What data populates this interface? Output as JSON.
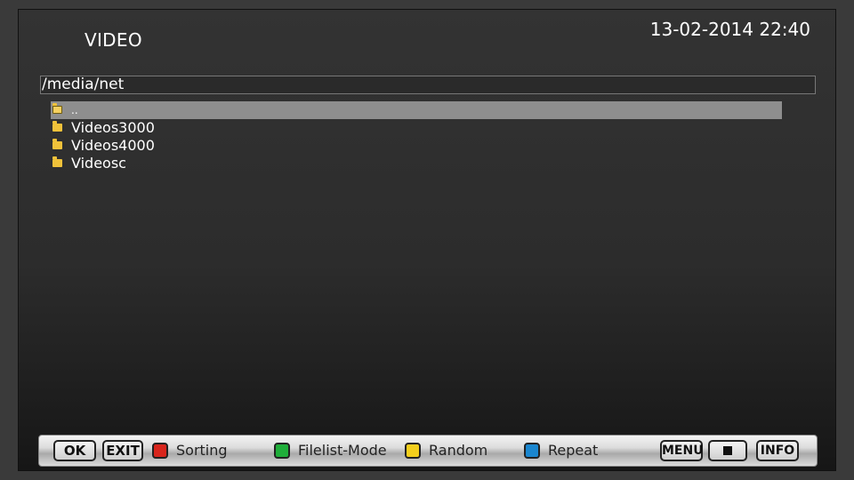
{
  "header": {
    "title": "VIDEO",
    "datetime": "13-02-2014 22:40"
  },
  "path": "/media/net",
  "files": [
    {
      "label": "..",
      "icon": "folder-up-icon",
      "selected": true
    },
    {
      "label": "Videos3000",
      "icon": "folder-icon",
      "selected": false
    },
    {
      "label": "Videos4000",
      "icon": "folder-icon",
      "selected": false
    },
    {
      "label": "Videosc",
      "icon": "folder-icon",
      "selected": false
    }
  ],
  "bottom_bar": {
    "ok": "OK",
    "exit": "EXIT",
    "red_label": "Sorting",
    "green_label": "Filelist-Mode",
    "yellow_label": "Random",
    "blue_label": "Repeat",
    "menu": "MENU",
    "stop_icon": "stop-icon",
    "info": "INFO"
  },
  "colors": {
    "red": "#d8251c",
    "green": "#1fae3a",
    "yellow": "#f4cf1c",
    "blue": "#1a86cf",
    "selection": "#8e8e8e",
    "folder": "#f0c23a"
  }
}
